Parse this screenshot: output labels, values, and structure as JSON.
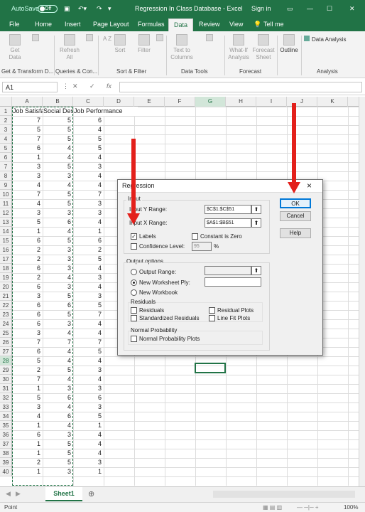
{
  "titlebar": {
    "autosave": "AutoSave",
    "autosave_state": "Off",
    "title": "Regression In Class Database  -  Excel",
    "signin": "Sign in"
  },
  "tabs": [
    "File",
    "Home",
    "Insert",
    "Page Layout",
    "Formulas",
    "Data",
    "Review",
    "View",
    "Tell me"
  ],
  "ribbon": {
    "get_data": "Get Data",
    "refresh_all": "Refresh All",
    "sort_az": "A Z",
    "sort": "Sort",
    "filter": "Filter",
    "text_to_columns": "Text to Columns",
    "what_if": "What-If Analysis",
    "forecast_sheet": "Forecast Sheet",
    "outline": "Outline",
    "data_analysis": "Data Analysis",
    "groups": [
      "Get & Transform D...",
      "Queries & Con...",
      "Sort & Filter",
      "Data Tools",
      "Forecast",
      "Analysis"
    ]
  },
  "formula_bar": {
    "name_box": "A1",
    "cancel": "✕",
    "enter": "✓",
    "fx": "fx"
  },
  "columns": [
    "A",
    "B",
    "C",
    "D",
    "E",
    "F",
    "G",
    "H",
    "I",
    "J",
    "K"
  ],
  "headers": [
    "Job Satisfaction",
    "Social Desirability",
    "Job Performance"
  ],
  "rows": [
    [
      7,
      5,
      6
    ],
    [
      5,
      5,
      4
    ],
    [
      7,
      5,
      5
    ],
    [
      6,
      4,
      5
    ],
    [
      1,
      4,
      4
    ],
    [
      3,
      5,
      3
    ],
    [
      3,
      3,
      4
    ],
    [
      4,
      4,
      4
    ],
    [
      7,
      5,
      7
    ],
    [
      4,
      5,
      3
    ],
    [
      3,
      3,
      3
    ],
    [
      5,
      6,
      4
    ],
    [
      1,
      4,
      1
    ],
    [
      6,
      5,
      6
    ],
    [
      2,
      3,
      2
    ],
    [
      2,
      3,
      5
    ],
    [
      6,
      3,
      4
    ],
    [
      2,
      4,
      3
    ],
    [
      6,
      3,
      4
    ],
    [
      3,
      5,
      3
    ],
    [
      6,
      6,
      5
    ],
    [
      6,
      5,
      7
    ],
    [
      6,
      3,
      4
    ],
    [
      3,
      4,
      4
    ],
    [
      7,
      7,
      7
    ],
    [
      6,
      4,
      5
    ],
    [
      5,
      4,
      4
    ],
    [
      2,
      5,
      3
    ],
    [
      7,
      4,
      4
    ],
    [
      1,
      3,
      3
    ],
    [
      5,
      6,
      6
    ],
    [
      3,
      4,
      3
    ],
    [
      4,
      6,
      5
    ],
    [
      1,
      4,
      1
    ],
    [
      6,
      3,
      4
    ],
    [
      1,
      5,
      4
    ],
    [
      1,
      5,
      4
    ],
    [
      2,
      5,
      3
    ],
    [
      1,
      3,
      1
    ]
  ],
  "sheet": {
    "tab": "Sheet1"
  },
  "status": {
    "mode": "Point",
    "zoom": "100%"
  },
  "dialog": {
    "title": "Regression",
    "input_section": "Input",
    "input_y_label": "Input Y Range:",
    "input_y_value": "$C$1:$C$51",
    "input_x_label": "Input X Range:",
    "input_x_value": "$A$1:$B$51",
    "labels": "Labels",
    "constant_zero": "Constant is Zero",
    "confidence_level": "Confidence Level:",
    "confidence_value": "95",
    "percent": "%",
    "output_section": "Output options",
    "output_range": "Output Range:",
    "new_worksheet": "New Worksheet Ply:",
    "new_workbook": "New Workbook",
    "residuals_section": "Residuals",
    "residuals": "Residuals",
    "standardized_residuals": "Standardized Residuals",
    "residual_plots": "Residual Plots",
    "line_fit_plots": "Line Fit Plots",
    "normal_section": "Normal Probability",
    "normal_plots": "Normal Probability Plots",
    "ok": "OK",
    "cancel": "Cancel",
    "help": "Help",
    "help_icon": "?",
    "close_icon": "×",
    "ref_icon": "⬆"
  },
  "colors": {
    "excel_green": "#217346",
    "arrow_red": "#e3201b"
  }
}
